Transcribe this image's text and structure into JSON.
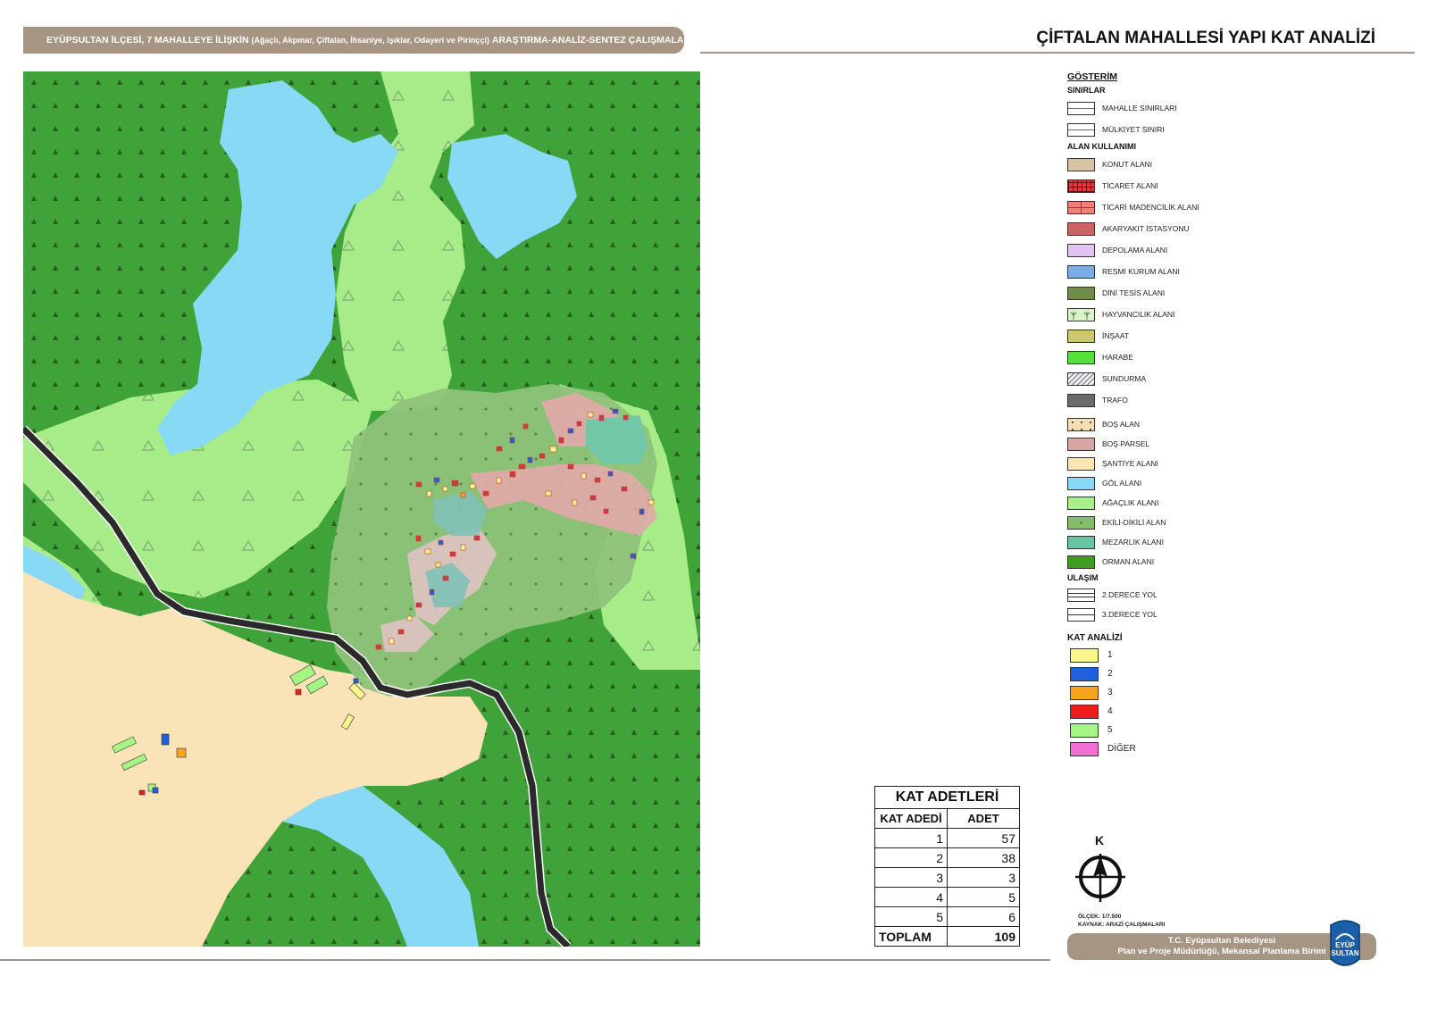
{
  "header": {
    "main": "EYÜPSULTAN İLÇESİ, 7 MAHALLEYE İLİŞKİN",
    "sub": "(Ağaçlı, Akpınar, Çiftalan, İhsaniye, Işıklar, Odayeri ve Pirinççi)",
    "tail": "ARAŞTIRMA-ANALİZ-SENTEZ ÇALIŞMALARI"
  },
  "page_title": "ÇİFTALAN MAHALLESİ YAPI KAT ANALİZİ",
  "legend": {
    "title": "GÖSTERİM",
    "sections": [
      {
        "name": "SINIRLAR",
        "items": [
          {
            "label": "MAHALLE SINIRLARI",
            "color": "#ffffff",
            "style": "line-purple"
          },
          {
            "label": "MÜLKİYET SINIRI",
            "color": "#ffffff",
            "style": "line-red"
          }
        ]
      },
      {
        "name": "ALAN KULLANIMI",
        "items": [
          {
            "label": "KONUT ALANI",
            "color": "#d9c3a5"
          },
          {
            "label": "TİCARET ALANI",
            "color": "#e5393b",
            "style": "grid"
          },
          {
            "label": "TİCARİ MADENCİLİK ALANI",
            "color": "#f08078",
            "style": "hgrid"
          },
          {
            "label": "AKARYAKIT İSTASYONU",
            "color": "#cd6464"
          },
          {
            "label": "DEPOLAMA ALANI",
            "color": "#e3c3f3"
          },
          {
            "label": "RESMİ KURUM ALANI",
            "color": "#78aee8"
          },
          {
            "label": "DİNİ TESİS ALANI",
            "color": "#6e8c46"
          },
          {
            "label": "HAYVANCILIK ALANI",
            "color": "#d9f4c8",
            "style": "tree"
          },
          {
            "label": "İNŞAAT",
            "color": "#cdc870"
          },
          {
            "label": "HARABE",
            "color": "#55e03c"
          },
          {
            "label": "SUNDURMA",
            "color": "#eeeef5",
            "style": "hatch"
          },
          {
            "label": "TRAFO",
            "color": "#6b6b6b"
          }
        ]
      },
      {
        "name": "",
        "items": [
          {
            "label": "BOŞ ALAN",
            "color": "#f6dfb3",
            "style": "dots"
          },
          {
            "label": "BOŞ PARSEL",
            "color": "#d9a3a3"
          },
          {
            "label": "ŞANTİYE ALANI",
            "color": "#fbe7b4"
          },
          {
            "label": "GÖL ALANI",
            "color": "#87d9f5"
          },
          {
            "label": "AĞAÇLIK ALANI",
            "color": "#a8ef8a"
          },
          {
            "label": "EKİLİ-DİKİLİ ALAN",
            "color": "#85bd68",
            "style": "dot-center"
          },
          {
            "label": "MEZARLIK ALANI",
            "color": "#6bc3a1"
          },
          {
            "label": "ORMAN ALANI",
            "color": "#3e9c1e"
          }
        ]
      },
      {
        "name": "ULAŞIM",
        "items": [
          {
            "label": "2.DERECE YOL",
            "color": "#ffffff",
            "style": "double"
          },
          {
            "label": "3.DERECE YOL",
            "color": "#ffffff",
            "style": "single"
          }
        ]
      }
    ],
    "kat_title": "KAT ANALİZİ",
    "kat_items": [
      {
        "label": "1",
        "color": "#fbf78b"
      },
      {
        "label": "2",
        "color": "#1f61dc"
      },
      {
        "label": "3",
        "color": "#f7a41c"
      },
      {
        "label": "4",
        "color": "#ee1c1c"
      },
      {
        "label": "5",
        "color": "#a6f685"
      },
      {
        "label": "DİĞER",
        "color": "#f36fd4"
      }
    ]
  },
  "kat_table": {
    "title": "KAT ADETLERİ",
    "col1": "KAT ADEDİ",
    "col2": "ADET",
    "rows": [
      {
        "kat": "1",
        "adet": "57"
      },
      {
        "kat": "2",
        "adet": "38"
      },
      {
        "kat": "3",
        "adet": "3"
      },
      {
        "kat": "4",
        "adet": "5"
      },
      {
        "kat": "5",
        "adet": "6"
      }
    ],
    "total_label": "TOPLAM",
    "total_value": "109"
  },
  "north_label": "K",
  "scale": "ÖLÇEK: 1/7.500",
  "source": "KAYNAK: ARAZİ ÇALIŞMALARI",
  "footer": {
    "line1": "T.C. Eyüpsultan Belediyesi",
    "line2": "Plan ve Proje Müdürlüğü, Mekansal Planlama Birimi"
  },
  "logo": {
    "line1": "EYÜP",
    "line2": "SULTAN"
  }
}
